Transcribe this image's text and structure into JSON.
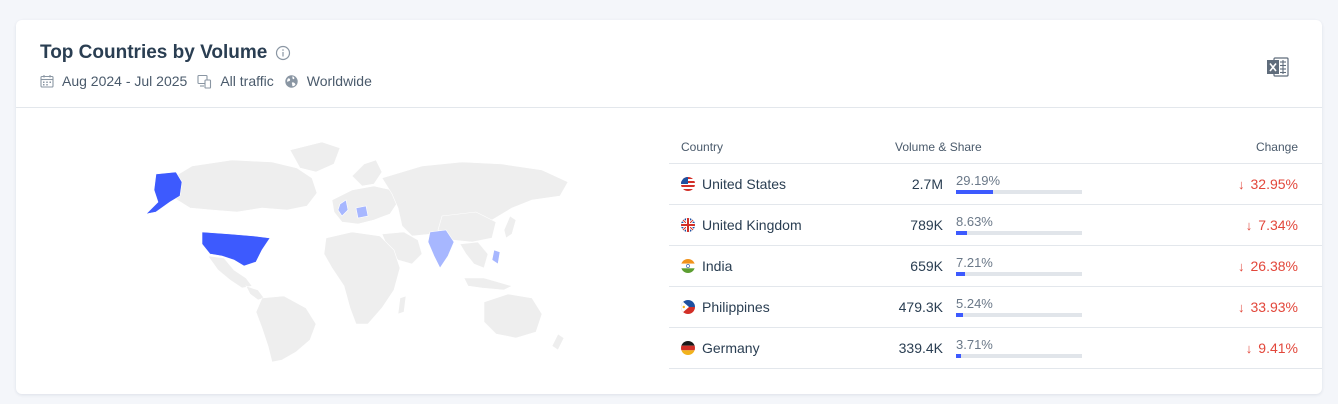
{
  "widget": {
    "title": "Top Countries by Volume",
    "date_range": "Aug 2024 - Jul 2025",
    "traffic_type": "All traffic",
    "region": "Worldwide"
  },
  "table": {
    "headers": {
      "country": "Country",
      "volume_share": "Volume & Share",
      "change": "Change"
    },
    "rows": [
      {
        "country": "United States",
        "volume": "2.7M",
        "share": "29.19%",
        "share_value": 29.19,
        "change": "32.95%",
        "direction": "down"
      },
      {
        "country": "United Kingdom",
        "volume": "789K",
        "share": "8.63%",
        "share_value": 8.63,
        "change": "7.34%",
        "direction": "down"
      },
      {
        "country": "India",
        "volume": "659K",
        "share": "7.21%",
        "share_value": 7.21,
        "change": "26.38%",
        "direction": "down"
      },
      {
        "country": "Philippines",
        "volume": "479.3K",
        "share": "5.24%",
        "share_value": 5.24,
        "change": "33.93%",
        "direction": "down"
      },
      {
        "country": "Germany",
        "volume": "339.4K",
        "share": "3.71%",
        "share_value": 3.71,
        "change": "9.41%",
        "direction": "down"
      }
    ]
  },
  "colors": {
    "accent": "#3d5afe",
    "map_top": "#3d5afe",
    "map_light": "#a7b7ff",
    "map_land": "#eeeeee",
    "negative": "#e2473b"
  },
  "icons": {
    "info": "info-icon",
    "calendar": "calendar-icon",
    "traffic": "devices-icon",
    "region": "globe-icon",
    "export": "excel-export-icon",
    "arrow": "arrow-down-icon"
  }
}
